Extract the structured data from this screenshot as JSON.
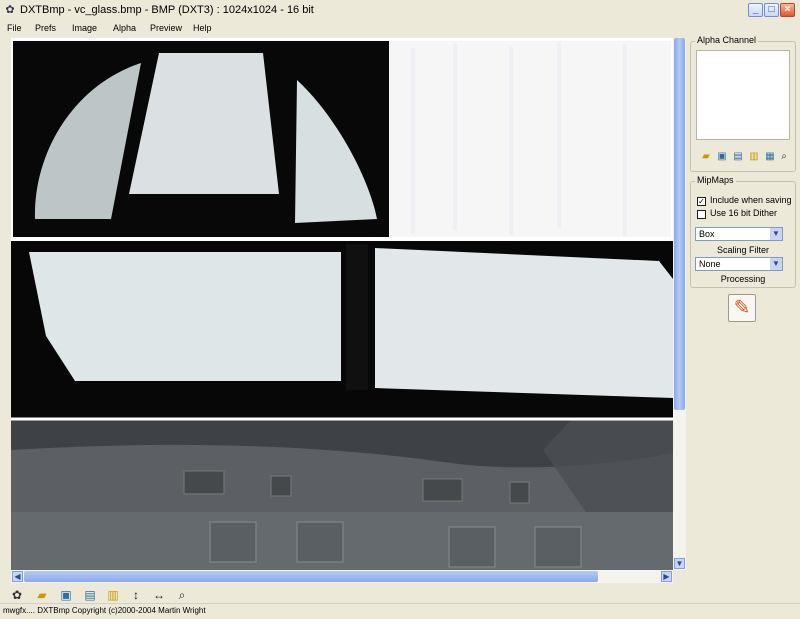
{
  "window": {
    "title": "DXTBmp - vc_glass.bmp - BMP (DXT3) : 1024x1024 - 16 bit",
    "app_icon": "butterfly-icon",
    "controls": [
      "minimize-icon",
      "maximize-icon",
      "close-icon"
    ]
  },
  "menu": [
    "File",
    "Prefs",
    "Image",
    "Alpha",
    "Preview",
    "Help"
  ],
  "right_panel": {
    "alpha_channel_label": "Alpha Channel",
    "alpha_tools": [
      "open-folder-icon",
      "save-icon",
      "import-icon",
      "export-icon",
      "view-alpha-icon",
      "zoom-icon"
    ],
    "mipmaps_label": "MipMaps",
    "include_when_saving": {
      "label": "Include when saving",
      "checked": true
    },
    "use_16bit_dither": {
      "label": "Use 16 bit Dither",
      "checked": false
    },
    "filter_value": "Box",
    "scaling_filter_label": "Scaling Filter",
    "processing_value": "None",
    "processing_label": "Processing",
    "brush_icon": "paint-brush-icon"
  },
  "toolbar": [
    "butterfly-icon",
    "open-icon",
    "save-icon",
    "import-icon",
    "export-icon",
    "flip-vertical-icon",
    "flip-horizontal-icon",
    "zoom-icon"
  ],
  "status": {
    "text": "mwgfx.... DXTBmp Copyright (c)2000-2004 Martin Wright"
  }
}
